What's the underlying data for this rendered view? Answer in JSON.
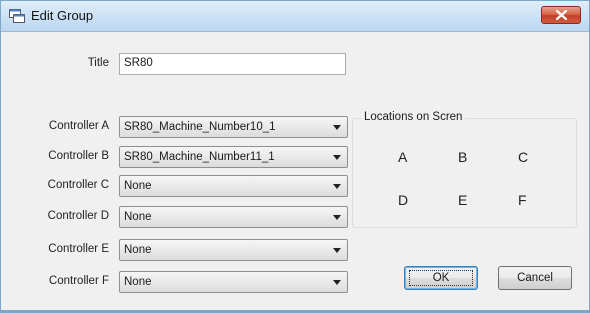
{
  "window": {
    "title": "Edit Group"
  },
  "form": {
    "title_label": "Title",
    "title_value": "SR80",
    "controllers": [
      {
        "label": "Controller A",
        "value": "SR80_Machine_Number10_1"
      },
      {
        "label": "Controller B",
        "value": "SR80_Machine_Number11_1"
      },
      {
        "label": "Controller C",
        "value": "None"
      },
      {
        "label": "Controller D",
        "value": "None"
      },
      {
        "label": "Controller E",
        "value": "None"
      },
      {
        "label": "Controller F",
        "value": "None"
      }
    ]
  },
  "locations": {
    "title": "Locations on Scren",
    "letters": [
      "A",
      "B",
      "C",
      "D",
      "E",
      "F"
    ]
  },
  "buttons": {
    "ok": "OK",
    "cancel": "Cancel"
  },
  "icons": {
    "app": "window-icon",
    "close": "close-icon",
    "dropdown": "chevron-down-icon"
  },
  "colors": {
    "titlebar": "#cfe3f6",
    "close_button": "#c2402a",
    "dialog_bg": "#f0f0f0"
  }
}
